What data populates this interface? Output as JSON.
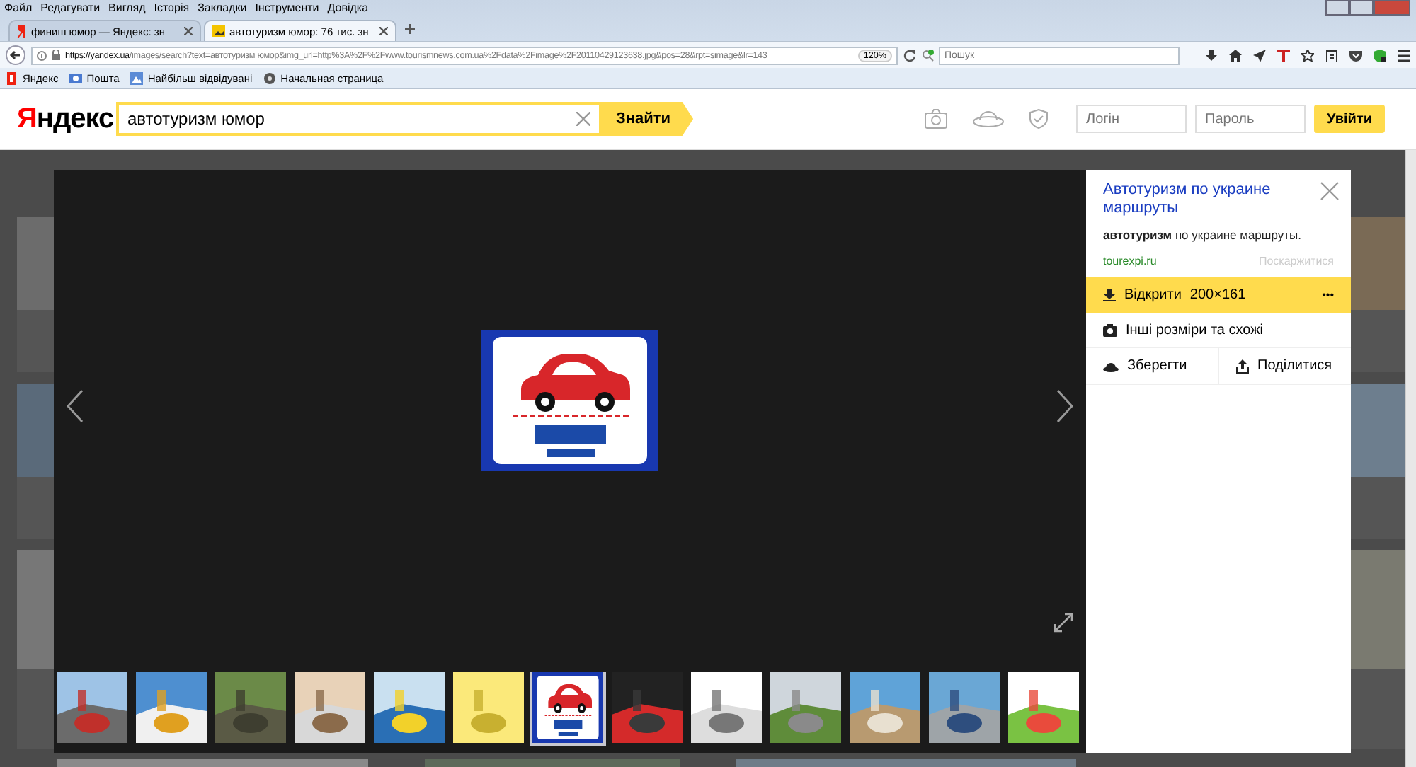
{
  "browser": {
    "menu": [
      "Файл",
      "Редагувати",
      "Вигляд",
      "Історія",
      "Закладки",
      "Інструменти",
      "Довідка"
    ],
    "tabs": [
      {
        "label": "финиш юмор — Яндекс: зн",
        "selected": false
      },
      {
        "label": "автотуризм юмор: 76 тис. зн",
        "selected": true
      }
    ],
    "url_host": "https://yandex.ua",
    "url_path": "/images/search?text=автотуризм юмор&img_url=http%3A%2F%2Fwww.tourismnews.com.ua%2Fdata%2Fimage%2F20110429123638.jpg&pos=28&rpt=simage&lr=143",
    "zoom": "120%",
    "search_placeholder": "Пошук",
    "bookmarks": [
      "Яндекс",
      "Пошта",
      "Найбільш відвідувані",
      "Начальная страница"
    ]
  },
  "header": {
    "logo": "Яндекс",
    "query": "автотуризм юмор",
    "search_button": "Знайти",
    "login_placeholder": "Логін",
    "password_placeholder": "Пароль",
    "login_button": "Увійти"
  },
  "viewer": {
    "main_image": {
      "kind": "picture"
    },
    "panel": {
      "title": "Автотуризм по украине маршруты",
      "snippet": "**автотуризм** по украине маршруты.",
      "domain": "tourexpi.ru",
      "complain": "Поскаржитися",
      "open": "Відкрити",
      "size": "200×161",
      "more": "•••",
      "similar": "Інші розміри та схожі",
      "save": "Зберегти",
      "share": "Поділитися"
    },
    "thumbnails": [
      {
        "kind": "picture",
        "selected": false
      },
      {
        "kind": "picture",
        "selected": false
      },
      {
        "kind": "picture",
        "selected": false
      },
      {
        "kind": "picture",
        "selected": false
      },
      {
        "kind": "picture",
        "selected": false
      },
      {
        "kind": "picture",
        "selected": false
      },
      {
        "kind": "picture",
        "selected": true
      },
      {
        "kind": "picture",
        "selected": false
      },
      {
        "kind": "picture",
        "selected": false
      },
      {
        "kind": "picture",
        "selected": false
      },
      {
        "kind": "picture",
        "selected": false
      },
      {
        "kind": "picture",
        "selected": false
      },
      {
        "kind": "picture",
        "selected": false
      }
    ]
  }
}
